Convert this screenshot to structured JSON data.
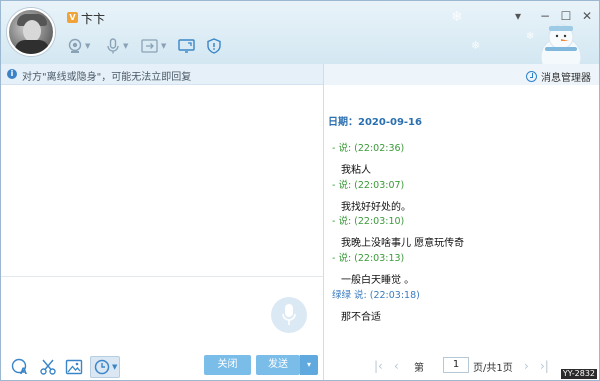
{
  "header": {
    "vip_badge": "V",
    "nickname": "卞卞",
    "window_controls": {
      "menu": "▾",
      "minimize": "−",
      "maximize": "☐",
      "close": "✕"
    }
  },
  "notice": {
    "text": "对方\"离线或隐身\"，可能无法立即回复"
  },
  "history": {
    "manager_label": "消息管理器",
    "date_line": "日期：2020-09-16",
    "messages": [
      {
        "sender": "- 说: (22:02:36)",
        "text": "我粘人"
      },
      {
        "sender": "- 说: (22:03:07)",
        "text": "我找好好处的。"
      },
      {
        "sender": "- 说: (22:03:10)",
        "text": "我晚上没啥事儿  愿意玩传奇"
      },
      {
        "sender": "- 说: (22:03:13)",
        "text": "一般白天睡觉  。"
      },
      {
        "sender": "绿绿 说: (22:03:18)",
        "text": "那不合适"
      }
    ],
    "pager": {
      "page_prefix": "第",
      "page_value": "1",
      "page_suffix": "页/共1页"
    }
  },
  "compose": {
    "close_label": "关闭",
    "send_label": "发送",
    "send_drop": "▾"
  },
  "watermark": "YY-2832",
  "colors": {
    "accent": "#2f82c8",
    "button": "#7bbde9",
    "sender_green": "#3a9a3a",
    "sender_blue": "#3a7bbf"
  },
  "icons": [
    "camera-icon",
    "microphone-icon",
    "transfer-file-icon",
    "screen-share-icon",
    "shield-icon",
    "font-style-icon",
    "scissors-icon",
    "image-icon",
    "history-clock-icon",
    "voice-input-icon",
    "message-manager-clock-icon"
  ]
}
